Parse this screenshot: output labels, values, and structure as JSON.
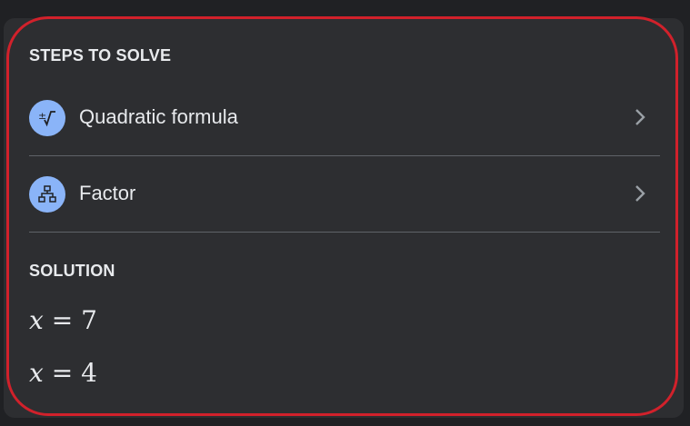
{
  "steps_section": {
    "title": "STEPS TO SOLVE",
    "items": [
      {
        "label": "Quadratic formula",
        "icon": "quadratic-formula-icon"
      },
      {
        "label": "Factor",
        "icon": "factor-tree-icon"
      }
    ]
  },
  "solution_section": {
    "title": "SOLUTION",
    "equations": [
      {
        "variable": "x",
        "operator": "=",
        "value": "7"
      },
      {
        "variable": "x",
        "operator": "=",
        "value": "4"
      }
    ]
  },
  "colors": {
    "background": "#202124",
    "card": "#2d2e31",
    "icon_fill": "#8ab4f8",
    "text": "#e8eaed",
    "divider": "#5f6368",
    "highlight_ring": "#d1212b"
  }
}
